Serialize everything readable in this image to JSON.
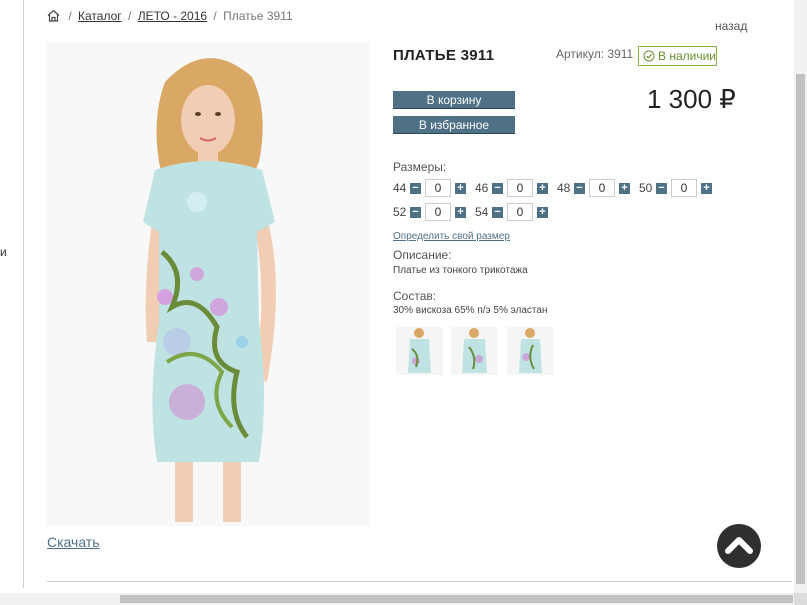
{
  "left_edge_glyph": "и",
  "breadcrumb": {
    "home_icon": "home-icon",
    "separator": "/",
    "items": [
      "Каталог",
      "ЛЕТО - 2016"
    ],
    "current": "Платье 3911"
  },
  "back_link": "назад",
  "product": {
    "title": "ПЛАТЬЕ 3911",
    "article": "Артикул: 3911",
    "stock": "В наличии",
    "price": "1 300 ₽",
    "add_to_cart": "В корзину",
    "add_to_favorites": "В избранное"
  },
  "sizes": {
    "label": "Размеры:",
    "items": [
      {
        "size": "44",
        "qty": "0"
      },
      {
        "size": "46",
        "qty": "0"
      },
      {
        "size": "48",
        "qty": "0"
      },
      {
        "size": "50",
        "qty": "0"
      },
      {
        "size": "52",
        "qty": "0"
      },
      {
        "size": "54",
        "qty": "0"
      }
    ],
    "minus": "−",
    "plus": "+"
  },
  "size_link": "Определить свой размер",
  "description": {
    "label": "Описание:",
    "text": "Платье из тонкого трикотажа"
  },
  "composition": {
    "label": "Состав:",
    "text": "30% вискоза 65% п/э 5% эластан"
  },
  "download_link": "Скачать",
  "colors": {
    "button": "#4f7186",
    "stock_green": "#6a8f30",
    "scroll_top": "#2f2f2f",
    "dress": "#bfe3e2"
  }
}
